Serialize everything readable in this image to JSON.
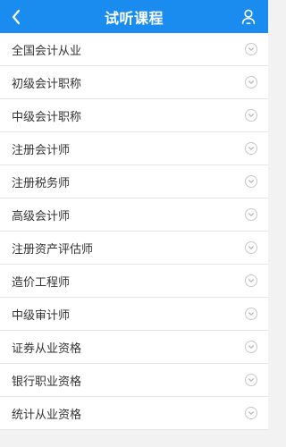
{
  "header": {
    "title": "试听课程",
    "back_icon": "chevron-left-icon",
    "user_icon": "user-profile-icon",
    "accent_color": "#1a8cf0"
  },
  "courses": [
    {
      "label": "全国会计从业",
      "icon": "chevron-down-circle-icon"
    },
    {
      "label": "初级会计职称",
      "icon": "chevron-down-circle-icon"
    },
    {
      "label": "中级会计职称",
      "icon": "chevron-down-circle-icon"
    },
    {
      "label": "注册会计师",
      "icon": "chevron-down-circle-icon"
    },
    {
      "label": "注册税务师",
      "icon": "chevron-down-circle-icon"
    },
    {
      "label": "高级会计师",
      "icon": "chevron-down-circle-icon"
    },
    {
      "label": "注册资产评估师",
      "icon": "chevron-down-circle-icon"
    },
    {
      "label": "造价工程师",
      "icon": "chevron-down-circle-icon"
    },
    {
      "label": "中级审计师",
      "icon": "chevron-down-circle-icon"
    },
    {
      "label": "证券从业资格",
      "icon": "chevron-down-circle-icon"
    },
    {
      "label": "银行职业资格",
      "icon": "chevron-down-circle-icon"
    },
    {
      "label": "统计从业资格",
      "icon": "chevron-down-circle-icon"
    }
  ]
}
